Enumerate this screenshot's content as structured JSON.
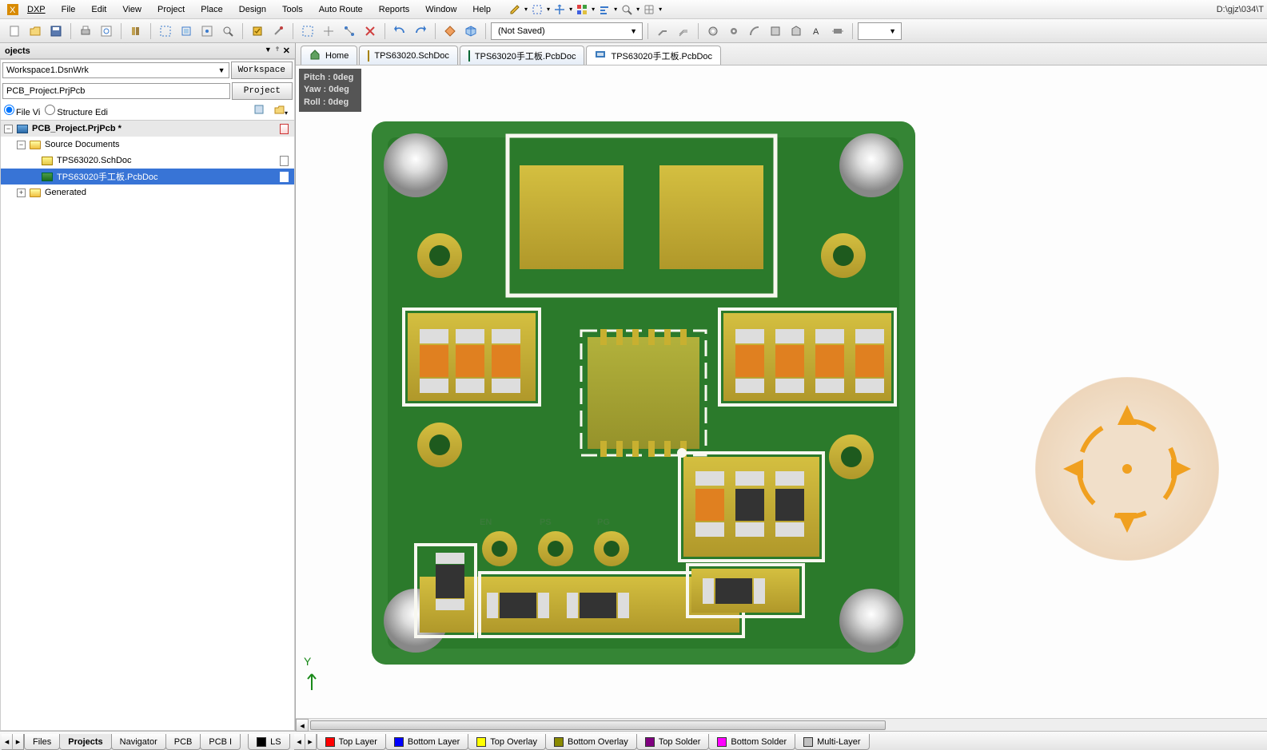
{
  "app": {
    "path_display": "D:\\gjz\\034\\T"
  },
  "menu": {
    "dxp": "DXP",
    "file": "File",
    "edit": "Edit",
    "view": "View",
    "project": "Project",
    "place": "Place",
    "design": "Design",
    "tools": "Tools",
    "autoroute": "Auto Route",
    "reports": "Reports",
    "window": "Window",
    "help": "Help"
  },
  "toolbar": {
    "combo_value": "(Not Saved)"
  },
  "projects_panel": {
    "title": "ojects",
    "workspace_value": "Workspace1.DsnWrk",
    "workspace_btn": "Workspace",
    "project_value": "PCB_Project.PrjPcb",
    "project_btn": "Project",
    "radio1": "File Vi",
    "radio2": "Structure Edi"
  },
  "tree": {
    "root": "PCB_Project.PrjPcb *",
    "src": "Source Documents",
    "doc1": "TPS63020.SchDoc",
    "doc2": "TPS63020手工板.PcbDoc",
    "gen": "Generated"
  },
  "doc_tabs": {
    "home": "Home",
    "t1": "TPS63020.SchDoc",
    "t2": "TPS63020手工板.PcbDoc",
    "t3": "TPS63020手工板.PcbDoc"
  },
  "orientation": {
    "pitch": "Pitch : 0deg",
    "yaw": "Yaw : 0deg",
    "roll": "Roll : 0deg"
  },
  "pcb_silk": {
    "en": "EN",
    "ps": "PS",
    "pg": "PG"
  },
  "bottom_left_tabs": {
    "files": "Files",
    "projects": "Projects",
    "navigator": "Navigator",
    "pcb": "PCB",
    "pcbi": "PCB I"
  },
  "layer_tabs": {
    "ls": "LS",
    "top": "Top Layer",
    "bot": "Bottom Layer",
    "tov": "Top Overlay",
    "bov": "Bottom Overlay",
    "tsol": "Top Solder",
    "bsol": "Bottom Solder",
    "ml": "Multi-Layer"
  },
  "layer_colors": {
    "ls": "#000000",
    "top": "#ff0000",
    "bot": "#0000ff",
    "tov": "#ffff00",
    "bov": "#8a8a00",
    "tsol": "#800080",
    "bsol": "#ff00ff",
    "ml": "#c0c0c0"
  }
}
